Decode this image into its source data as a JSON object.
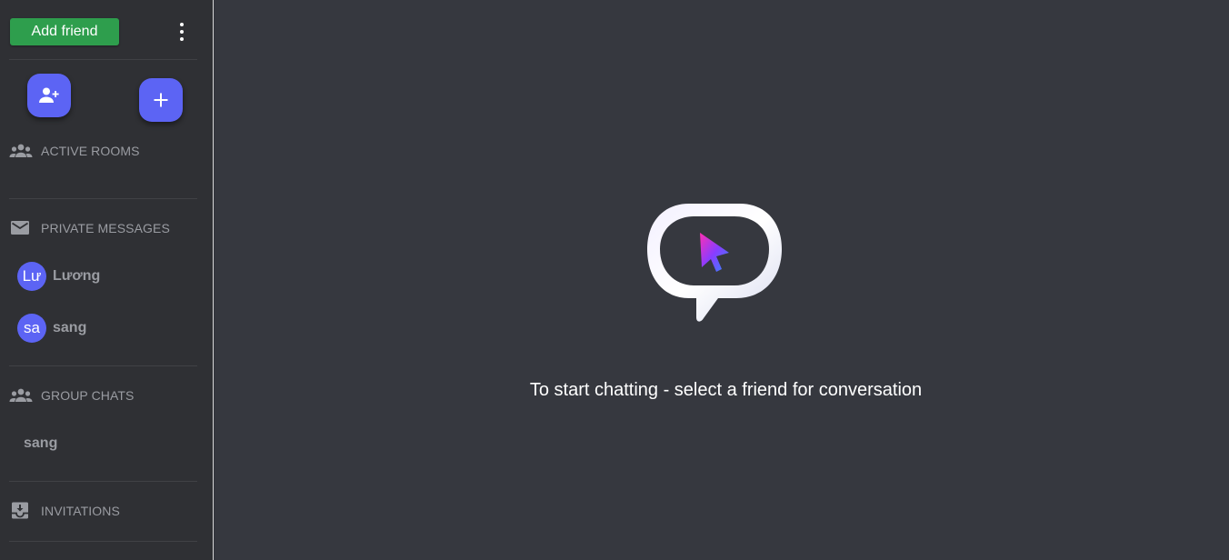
{
  "sidebar": {
    "add_friend_label": "Add friend",
    "sections": {
      "active_rooms": "ACTIVE ROOMS",
      "private_messages": "PRIVATE MESSAGES",
      "group_chats": "GROUP CHATS",
      "invitations": "INVITATIONS"
    },
    "private_contacts": [
      {
        "initials": "Lư",
        "name": "Lương"
      },
      {
        "initials": "sa",
        "name": "sang"
      }
    ],
    "group_chats": [
      {
        "name": "sang"
      }
    ],
    "icons": {
      "menu": "more-vertical-icon",
      "add_friend_fab": "person-add-icon",
      "create_fab": "plus-icon",
      "active_rooms": "people-icon",
      "private_messages": "mail-icon",
      "group_chats": "people-icon",
      "invitations": "inbox-download-icon"
    }
  },
  "main": {
    "empty_message": "To start chatting - select a friend for conversation",
    "empty_icon": "chat-bubble-cursor-icon"
  },
  "colors": {
    "primary": "#5c64f4",
    "success": "#2e9e4d",
    "sidebar_bg": "#2f3034",
    "main_bg": "#36383f",
    "muted_text": "#9a9ca2"
  }
}
